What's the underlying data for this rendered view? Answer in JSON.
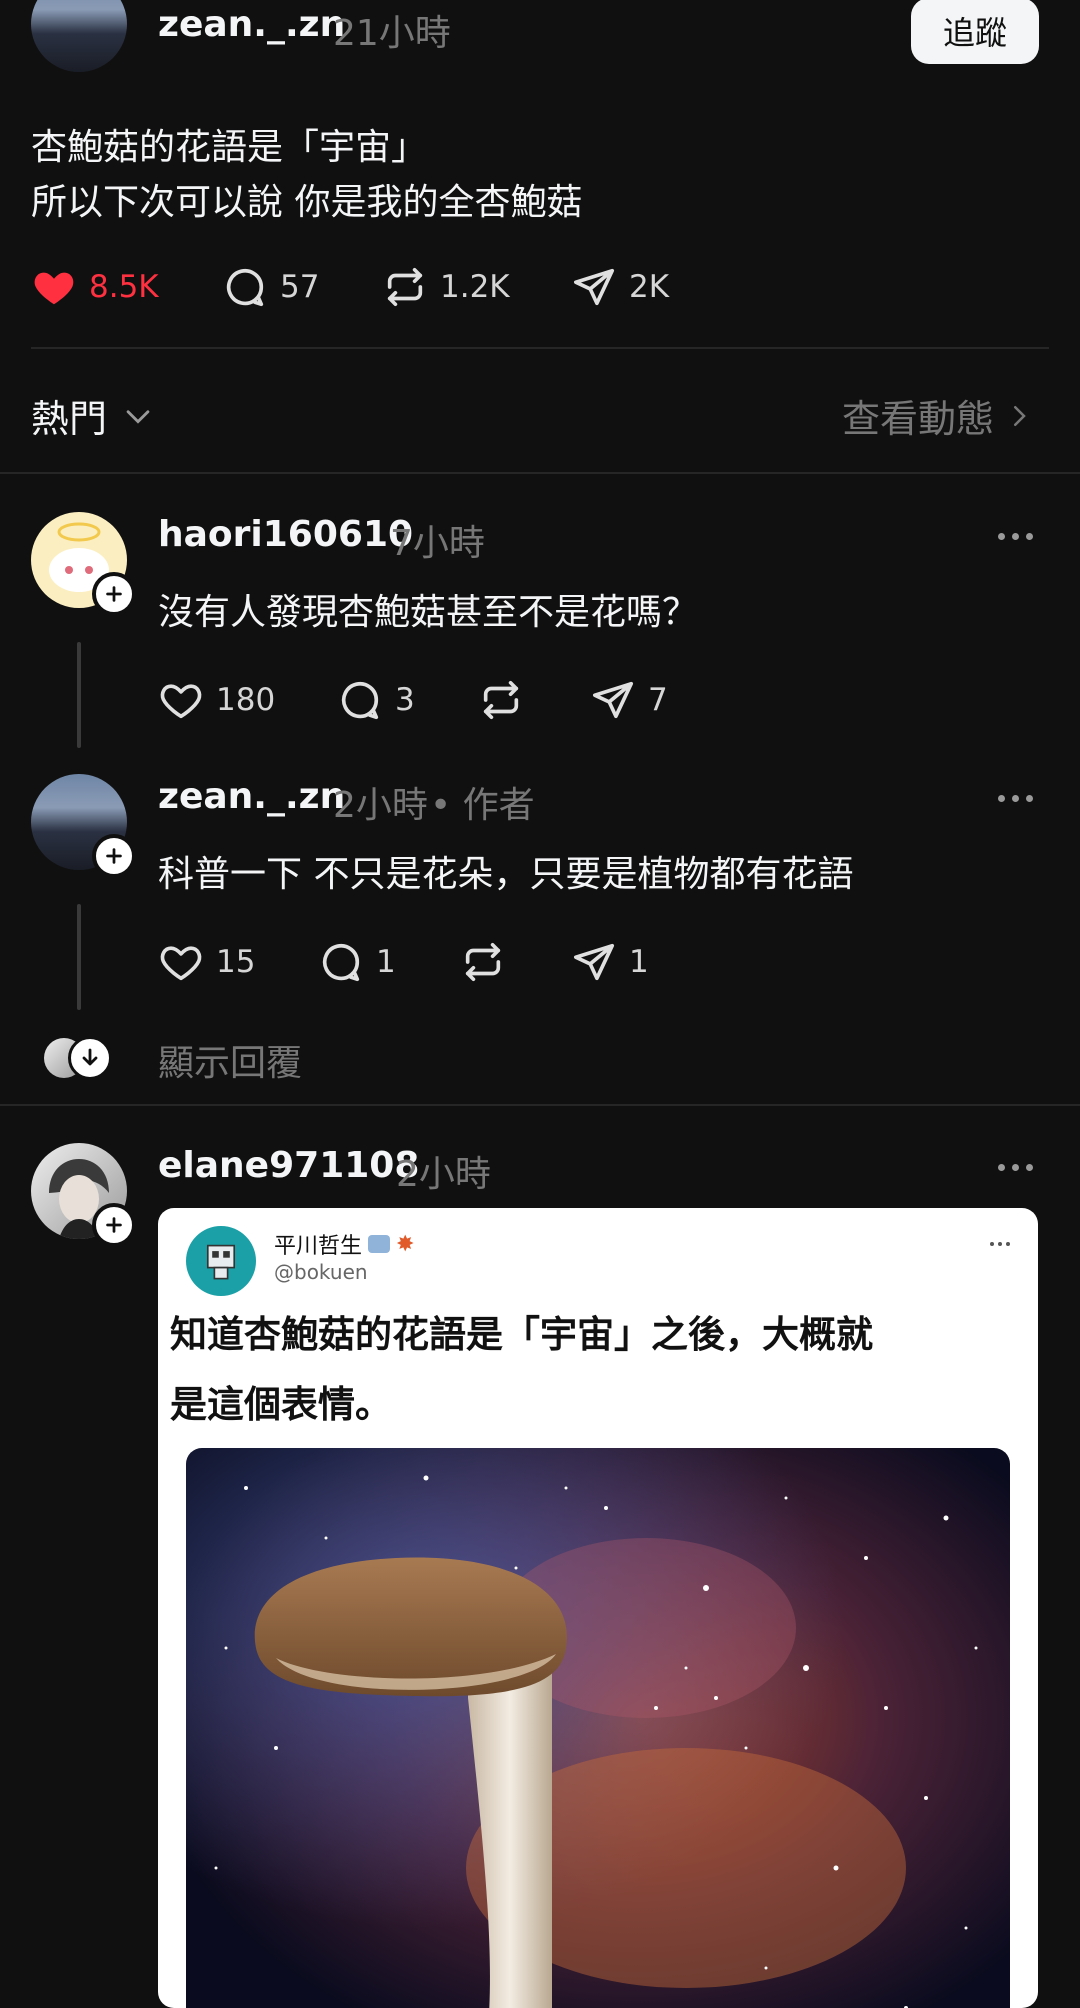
{
  "post": {
    "username": "zean._.zn",
    "time": "21小時",
    "follow_label": "追蹤",
    "text_line1": "杏鮑菇的花語是「宇宙」",
    "text_line2": "所以下次可以說 你是我的全杏鮑菇",
    "likes": "8.5K",
    "comments": "57",
    "reposts": "1.2K",
    "shares": "2K"
  },
  "sort": {
    "label": "熱門",
    "activity_link": "查看動態"
  },
  "replies": [
    {
      "username": "haori160610",
      "time": "7小時",
      "text": "沒有人發現杏鮑菇甚至不是花嗎？",
      "likes": "180",
      "comments": "3",
      "shares": "7"
    },
    {
      "username": "zean._.zn",
      "time": "2小時",
      "author_tag": "• 作者",
      "text": "科普一下 不只是花朵，只要是植物都有花語",
      "likes": "15",
      "comments": "1",
      "shares": "1"
    }
  ],
  "show_replies_label": "顯示回覆",
  "third_reply": {
    "username": "elane971108",
    "time": "2小時",
    "embedded": {
      "name": "平川哲生",
      "handle": "@bokuen",
      "text_line1": "知道杏鮑菇的花語是「宇宙」之後，大概就",
      "text_line2": "是這個表情。",
      "image_subject": "king-oyster-mushroom-in-galaxy"
    }
  },
  "colors": {
    "background": "#101010",
    "like_red": "#ff3040",
    "muted": "#777777"
  }
}
